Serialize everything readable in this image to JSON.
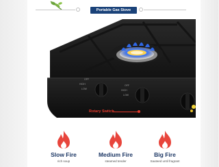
{
  "header": {
    "title": "Portable Gas Stove"
  },
  "product_image": {
    "annotation_label": "Rotary Switch",
    "knob_markings": {
      "off": "OFF",
      "high": "HIGH",
      "low": "LOW"
    }
  },
  "fire_levels": [
    {
      "title": "Slow Fire",
      "subtitle": "rich soup",
      "icon": "flame-icon",
      "color": "#e8453c"
    },
    {
      "title": "Medium Fire",
      "subtitle": "steamed tender",
      "icon": "flame-icon",
      "color": "#e8453c"
    },
    {
      "title": "Big Fire",
      "subtitle": "Sauteed until fragrant",
      "icon": "flame-icon",
      "color": "#e8453c"
    }
  ],
  "colors": {
    "title_pill": "#1a4279",
    "heading_text": "#1a3563",
    "accent_red": "#e6392b",
    "burner_blue": "#2f6bf0"
  }
}
